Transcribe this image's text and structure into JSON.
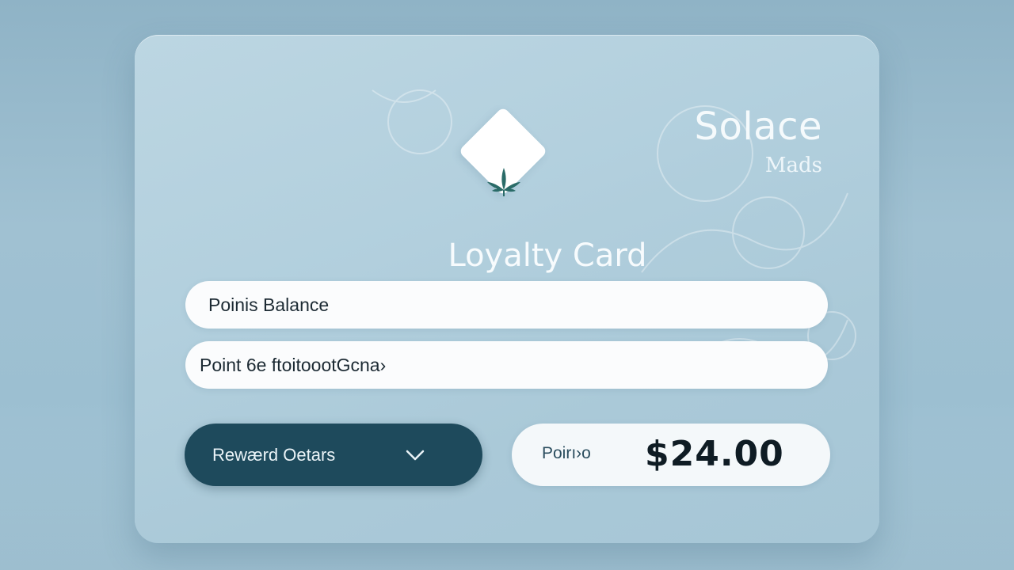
{
  "brand": {
    "name": "Solace",
    "subtitle": "Mads",
    "logo_icon": "cannabis-leaf-icon"
  },
  "card": {
    "title": "Loyalty Card",
    "fields": [
      {
        "label": "Poinis Balance"
      },
      {
        "label": "Point 6e ftoitoootGcna›"
      }
    ]
  },
  "actions": {
    "reward_button_label": "Rewærd Oetars",
    "reward_button_icon": "chevron-down-icon"
  },
  "points": {
    "label": "Poirı›o",
    "value": "$24.00"
  },
  "colors": {
    "card_background": "#b3d0de",
    "button_dark": "#1e4a5c",
    "leaf_accent": "#2a6b68",
    "text_light": "#f7fbfd"
  }
}
